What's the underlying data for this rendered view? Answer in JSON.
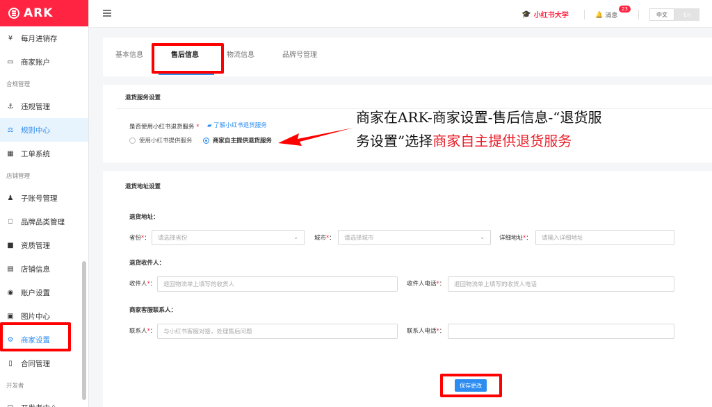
{
  "app": {
    "logo_text": "ARK"
  },
  "sidebar": {
    "items": [
      {
        "icon": "yen-icon",
        "glyph": "¥",
        "label": "每月进销存"
      },
      {
        "icon": "card-icon",
        "glyph": "▭",
        "label": "商家账户"
      },
      {
        "group": "合规管理"
      },
      {
        "icon": "anchor-icon",
        "glyph": "⚓",
        "label": "违规管理"
      },
      {
        "icon": "scale-icon",
        "glyph": "⚖",
        "label": "规则中心"
      },
      {
        "icon": "calendar-icon",
        "glyph": "▦",
        "label": "工单系统"
      },
      {
        "group": "店铺管理"
      },
      {
        "icon": "user-icon",
        "glyph": "♟",
        "label": "子账号管理"
      },
      {
        "icon": "bookmark-icon",
        "glyph": "⎕",
        "label": "品牌品类管理"
      },
      {
        "icon": "flag-icon",
        "glyph": "■",
        "label": "资质管理"
      },
      {
        "icon": "id-card-icon",
        "glyph": "▤",
        "label": "店铺信息"
      },
      {
        "icon": "account-icon",
        "glyph": "◉",
        "label": "账户设置"
      },
      {
        "icon": "image-icon",
        "glyph": "▣",
        "label": "图片中心"
      },
      {
        "icon": "gear-icon",
        "glyph": "⚙",
        "label": "商家设置"
      },
      {
        "icon": "contract-icon",
        "glyph": "▯",
        "label": "合同管理"
      },
      {
        "group": "开发者"
      },
      {
        "icon": "dev-icon",
        "glyph": "▢",
        "label": "开发者中心"
      }
    ]
  },
  "topbar": {
    "university": "小红书大学",
    "messages_label": "消息",
    "messages_count": "23",
    "lang_zh": "中文",
    "lang_en": "En"
  },
  "tabs": [
    "基本信息",
    "售后信息",
    "物流信息",
    "品牌号管理"
  ],
  "return_service": {
    "title": "退货服务设置",
    "question": "是否使用小红书退货服务",
    "learn_more": "了解小红书退货服务",
    "option_a": "使用小红书提供服务",
    "option_b": "商家自主提供退货服务"
  },
  "return_address": {
    "title": "退货地址设置",
    "address_section": "退货地址：",
    "province_label": "省份",
    "province_placeholder": "请选择省份",
    "city_label": "城市",
    "city_placeholder": "请选择城市",
    "detail_label": "详细地址",
    "detail_placeholder": "请输入详细地址",
    "receiver_section": "退货收件人：",
    "receiver_label": "收件人",
    "receiver_placeholder": "退回物流单上填写的收货人",
    "receiver_phone_label": "收件人电话",
    "receiver_phone_placeholder": "退回物流单上填写的收货人电话",
    "cs_section": "商家客服联系人：",
    "contact_label": "联系人",
    "contact_placeholder": "与小红书客服对接，处理售后问题",
    "contact_phone_label": "联系人电话"
  },
  "save_button": "保存更改",
  "annotation": {
    "part1": "商家在ARK-商家设置-售后信息-“退货服务设置”选择",
    "part2": "商家自主提供退货服务"
  },
  "colors": {
    "brand": "#ff2442",
    "accent": "#2d8cf0",
    "annotation_red": "#ff0000"
  }
}
